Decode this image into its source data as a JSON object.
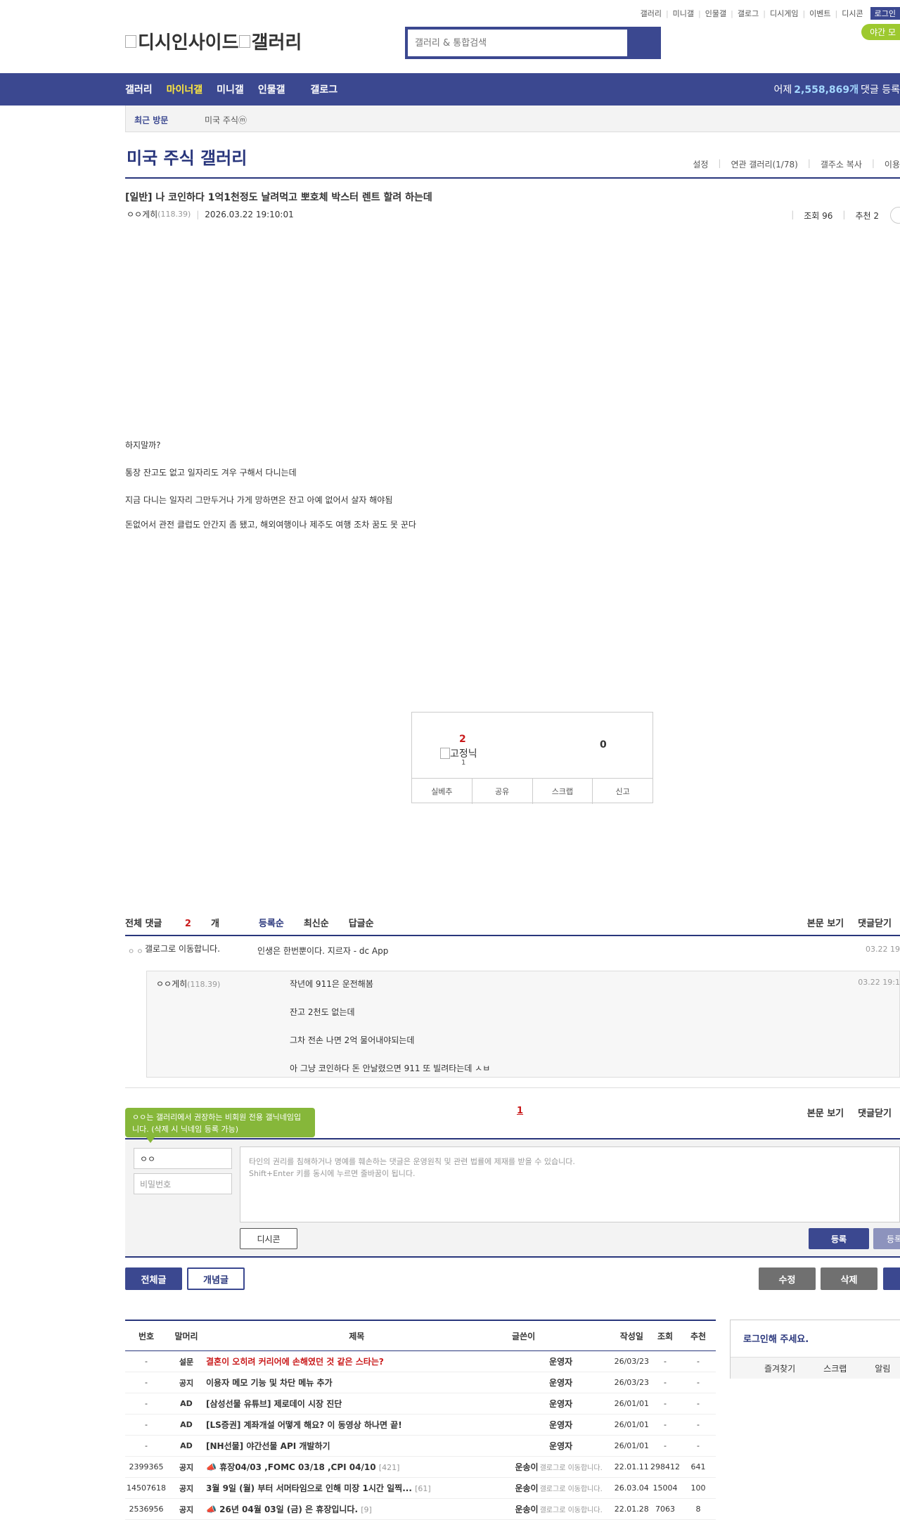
{
  "header": {
    "util_links": [
      "갤러리",
      "미니갤",
      "인물갤",
      "갤로그",
      "디시게임",
      "이벤트",
      "디시콘"
    ],
    "login": "로그인",
    "night_mode": "야간 모",
    "logo_text": "디시인사이드",
    "logo_sub": "갤러리",
    "search_placeholder": "갤러리 & 통합검색"
  },
  "gnb": {
    "items": [
      "갤러리",
      "마이너갤",
      "미니갤",
      "인물갤",
      "갤로그"
    ],
    "active_index": 1,
    "right_prefix": "어제",
    "right_count": "2,558,869개",
    "right_suffix": "댓글 등록"
  },
  "recent": {
    "label": "최근 방문",
    "gallery": "미국 주식ⓜ"
  },
  "gallery": {
    "title": "미국 주식 갤러리",
    "options": [
      "설정",
      "연관 갤러리(1/78)",
      "갤주소 복사",
      "이용"
    ]
  },
  "post": {
    "title": "[일반] 나 코인하다 1억1천정도 날려먹고 뽀호체 박스터 렌트 할려 하는데",
    "author": "ㅇㅇ게히",
    "ip": "(118.39)",
    "date": "2026.03.22 19:10:01",
    "views": "조회 96",
    "recommends": "추천 2",
    "body": [
      "하지말까?",
      "통장 잔고도 없고 일자리도 겨우 구해서 다니는데",
      "지금 다니는 일자리 그만두거나 가게 망하면은 잔고 아예 없어서 살자 해야됨",
      "돈없어서 관전 클럽도 안간지 좀 됐고, 해외여행이나 제주도 여행 조차 꿈도 못 꾼다"
    ]
  },
  "recommend": {
    "up": "2",
    "fixed_label": "고정닉",
    "fixed_count": "1",
    "down": "0",
    "buttons": [
      "실베추",
      "공유",
      "스크랩",
      "신고"
    ]
  },
  "comments": {
    "total_label": "전체 댓글",
    "total_count": "2",
    "total_unit": "개",
    "sorts": [
      "등록순",
      "최신순",
      "답글순"
    ],
    "right_links": [
      "본문 보기",
      "댓글닫기"
    ],
    "items": [
      {
        "author": "갤로그로 이동합니다.",
        "text": "인생은 한번뿐이다. 지르자 - dc App",
        "date": "03.22 19"
      }
    ],
    "reply": {
      "author": "ㅇㅇ게히",
      "ip": "(118.39)",
      "date": "03.22 19:1",
      "lines": [
        "작년에 911은 운전해봄",
        "잔고 2천도 없는데",
        "그차 전손 나면 2억 물어내야되는데",
        "아 그냥 코인하다 돈 안날렸으면 911 또 빌려타는데 ㅅㅂ"
      ]
    },
    "page": "1"
  },
  "comment_form": {
    "tooltip": "ㅇㅇ는 갤러리에서 권장하는 비회원 전용 갤닉네임입니다. (삭제 시 닉네임 등록 가능)",
    "nickname": "ㅇㅇ",
    "password_placeholder": "비밀번호",
    "textarea_hint1": "타인의 권리를 침해하거나 명예를 훼손하는 댓글은 운영원칙 및 관련 법률에 제재를 받을 수 있습니다.",
    "textarea_hint2": "Shift+Enter 키를 동시에 누르면 줄바꿈이 됩니다.",
    "dccon": "디시콘",
    "submit": "등록",
    "submit2": "등록"
  },
  "buttons": {
    "all": "전체글",
    "concept": "개념글",
    "edit": "수정",
    "delete": "삭제"
  },
  "list": {
    "headers": [
      "번호",
      "말머리",
      "제목",
      "글쓴이",
      "작성일",
      "조회",
      "추천"
    ],
    "rows": [
      {
        "no": "-",
        "tag": "설문",
        "title": "결혼이 오히려 커리어에 손해였던 것 같은 스타는?",
        "red": true,
        "count": "",
        "writer": "운영자",
        "gallog": "",
        "date": "26/03/23",
        "views": "-",
        "rec": "-"
      },
      {
        "no": "-",
        "tag": "공지",
        "title": "이용자 메모 기능 및 차단 메뉴 추가",
        "red": false,
        "count": "",
        "writer": "운영자",
        "gallog": "",
        "date": "26/03/23",
        "views": "-",
        "rec": "-"
      },
      {
        "no": "-",
        "tag": "AD",
        "title": "[삼성선물 유튜브] 제로데이 시장 진단",
        "red": false,
        "count": "",
        "writer": "운영자",
        "gallog": "",
        "date": "26/01/01",
        "views": "-",
        "rec": "-"
      },
      {
        "no": "-",
        "tag": "AD",
        "title": "[LS증권] 계좌개설 어떻게 해요? 이 동영상 하나면 끝!",
        "red": false,
        "count": "",
        "writer": "운영자",
        "gallog": "",
        "date": "26/01/01",
        "views": "-",
        "rec": "-"
      },
      {
        "no": "-",
        "tag": "AD",
        "title": "[NH선물] 야간선물 API 개발하기",
        "red": false,
        "count": "",
        "writer": "운영자",
        "gallog": "",
        "date": "26/01/01",
        "views": "-",
        "rec": "-"
      },
      {
        "no": "2399365",
        "tag": "공지",
        "title": "📣 휴장04/03 ,FOMC 03/18 ,CPI 04/10",
        "red": false,
        "count": "[421]",
        "writer": "운송이",
        "gallog": "갤로그로 이동합니다.",
        "date": "22.01.11",
        "views": "298412",
        "rec": "641"
      },
      {
        "no": "14507618",
        "tag": "공지",
        "title": "3월 9일 (월) 부터 서머타임으로 인해 미장 1시간 일찍...",
        "red": false,
        "count": "[61]",
        "writer": "운송이",
        "gallog": "갤로그로 이동합니다.",
        "date": "26.03.04",
        "views": "15004",
        "rec": "100"
      },
      {
        "no": "2536956",
        "tag": "공지",
        "title": "📣 26년 04월 03일 (금) 은 휴장입니다.",
        "red": false,
        "count": "[9]",
        "writer": "운송이",
        "gallog": "갤로그로 이동합니다.",
        "date": "22.01.28",
        "views": "7063",
        "rec": "8"
      }
    ]
  },
  "login_box": {
    "title": "로그인해 주세요.",
    "links": [
      "즐겨찾기",
      "스크랩",
      "알림"
    ]
  }
}
